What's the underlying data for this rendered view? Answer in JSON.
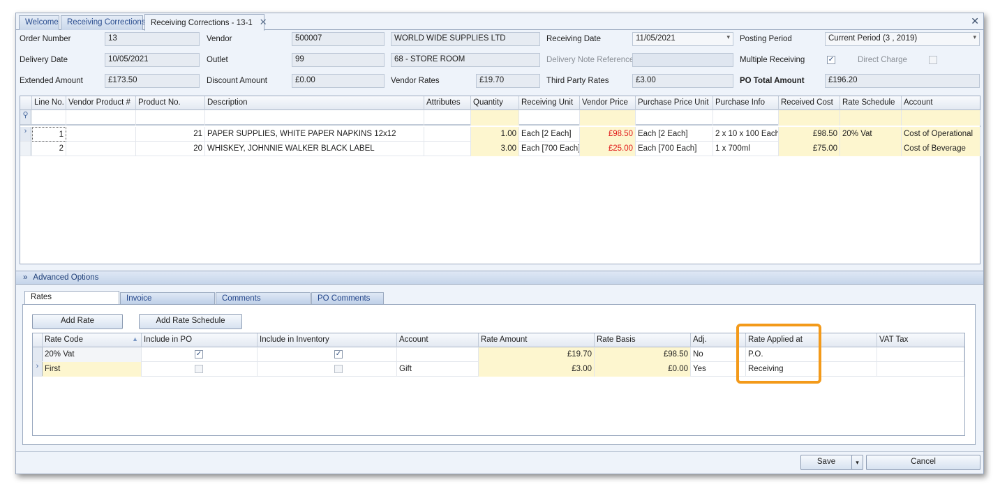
{
  "tabs": [
    "Welcome",
    "Receiving Corrections",
    "Receiving Corrections - 13-1"
  ],
  "header": {
    "order_number_label": "Order Number",
    "order_number": "13",
    "vendor_label": "Vendor",
    "vendor_code": "500007",
    "vendor_name": "WORLD WIDE SUPPLIES LTD",
    "receiving_date_label": "Receiving Date",
    "receiving_date": "11/05/2021",
    "posting_period_label": "Posting Period",
    "posting_period": "Current Period (3 , 2019)",
    "delivery_date_label": "Delivery Date",
    "delivery_date": "10/05/2021",
    "outlet_label": "Outlet",
    "outlet_code": "99",
    "outlet_name": "68 - STORE ROOM",
    "delivery_note_label": "Delivery Note Reference",
    "delivery_note": "",
    "multiple_receiving_label": "Multiple Receiving",
    "direct_charge_label": "Direct Charge",
    "extended_amount_label": "Extended Amount",
    "extended_amount": "£173.50",
    "discount_amount_label": "Discount Amount",
    "discount_amount": "£0.00",
    "vendor_rates_label": "Vendor Rates",
    "vendor_rates": "£19.70",
    "third_party_rates_label": "Third Party Rates",
    "third_party_rates": "£3.00",
    "po_total_label": "PO Total Amount",
    "po_total": "£196.20"
  },
  "lines": {
    "columns": [
      "Line No.",
      "Vendor Product #",
      "Product No.",
      "Description",
      "Attributes",
      "Quantity",
      "Receiving Unit",
      "Vendor Price",
      "Purchase Price Unit",
      "Purchase Info",
      "Received Cost",
      "Rate Schedule",
      "Account"
    ],
    "rows": [
      [
        "1",
        "",
        "21",
        "PAPER SUPPLIES, WHITE PAPER NAPKINS 12x12",
        "",
        "1.00",
        "Each [2 Each]",
        "£98.50",
        "Each [2 Each]",
        "2 x 10 x 100 Each",
        "£98.50",
        "20% Vat",
        "Cost of Operational"
      ],
      [
        "2",
        "",
        "20",
        "WHISKEY, JOHNNIE WALKER BLACK LABEL",
        "",
        "3.00",
        "Each [700 Each]",
        "£25.00",
        "Each [700 Each]",
        "1 x 700ml",
        "£75.00",
        "",
        "Cost of Beverage"
      ]
    ]
  },
  "advanced": {
    "title": "Advanced Options",
    "tabs": [
      "Rates",
      "Invoice",
      "Comments",
      "PO Comments"
    ],
    "add_rate": "Add Rate",
    "add_rate_schedule": "Add Rate Schedule",
    "columns": [
      "Rate Code",
      "Include in PO",
      "Include in Inventory",
      "Account",
      "Rate Amount",
      "Rate Basis",
      "Adj.",
      "Rate Applied at",
      "VAT Tax"
    ],
    "rows": [
      [
        "20% Vat",
        "",
        "",
        "",
        "£19.70",
        "£98.50",
        "No",
        "P.O.",
        ""
      ],
      [
        "First",
        "",
        "",
        "Gift",
        "£3.00",
        "£0.00",
        "Yes",
        "Receiving",
        ""
      ]
    ]
  },
  "footer": {
    "save": "Save",
    "cancel": "Cancel"
  },
  "colors": {
    "highlight": "#f39a1a",
    "price_red": "#e01818",
    "editable_yellow": "#fdf6cf"
  }
}
